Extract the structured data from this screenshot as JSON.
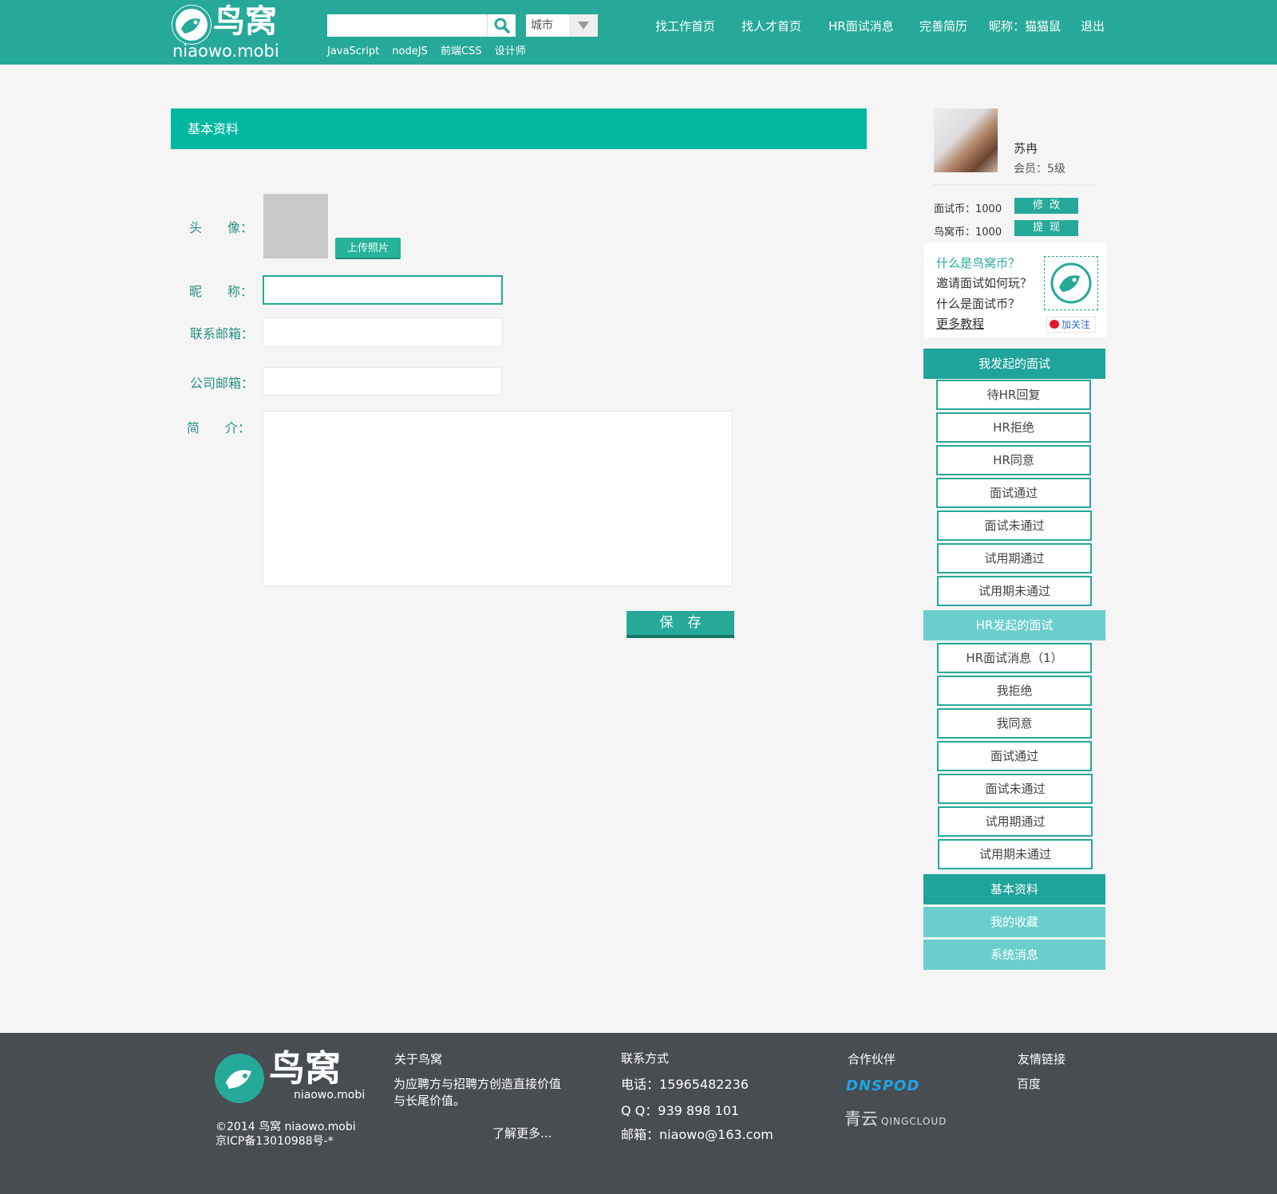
{
  "header": {
    "logo_cn": "鸟窝",
    "logo_en": "niaowo.mobi",
    "search_placeholder": "",
    "city": "城市",
    "hot_tags": [
      "JavaScript",
      "nodeJS",
      "前端CSS",
      "设计师"
    ],
    "nav": {
      "find_job": "找工作首页",
      "find_talent": "找人才首页",
      "hr_messages": "HR面试消息",
      "resume": "完善简历",
      "nickname": "昵称：猫猫鼠",
      "logout": "退出"
    }
  },
  "main": {
    "title": "基本资料",
    "labels": {
      "avatar": "头　　像：",
      "nickname": "昵　　称：",
      "contact_email": "联系邮箱：",
      "company_email": "公司邮箱：",
      "intro": "简　　介："
    },
    "upload_label": "上传照片",
    "values": {
      "nickname": "",
      "contact_email": "",
      "company_email": "",
      "intro": ""
    },
    "save_label": "保存"
  },
  "sidebar": {
    "name": "苏冉",
    "level": "会员：5级",
    "interview_coins": "面试币：1000",
    "niaowo_coins": "鸟窝币：1000",
    "edit_label": "修改",
    "withdraw_label": "提现",
    "tutorial": {
      "q1": "什么是鸟窝币？",
      "q2": "邀请面试如何玩？",
      "q3": "什么是面试币？",
      "more": "更多教程",
      "follow": "加关注"
    },
    "my_interviews_title": "我发起的面试",
    "my_interviews": [
      "待HR回复",
      "HR拒绝",
      "HR同意",
      "面试通过",
      "面试未通过",
      "试用期通过",
      "试用期未通过"
    ],
    "hr_interviews_title": "HR发起的面试",
    "hr_interviews": [
      "HR面试消息（1）",
      "我拒绝",
      "我同意",
      "面试通过",
      "面试未通过",
      "试用期通过",
      "试用期未通过"
    ],
    "nav": [
      "基本资料",
      "我的收藏",
      "系统消息"
    ]
  },
  "footer": {
    "logo_cn": "鸟窝",
    "logo_en": "niaowo.mobi",
    "copyright": "©2014 鸟窝 niaowo.mobi",
    "icp": "京ICP备13010988号-*",
    "about_title": "关于鸟窝",
    "about_text": "为应聘方与招聘方创造直接价值与长尾价值。",
    "about_more": "了解更多...",
    "contact_title": "联系方式",
    "phone": "电话：15965482236",
    "qq": "Q Q：939 898 101",
    "email": "邮箱：niaowo@163.com",
    "partners_title": "合作伙伴",
    "partner1": "DNSPOD",
    "partner2_cn": "青云",
    "partner2_en": "QINGCLOUD",
    "links_title": "友情链接",
    "link1": "百度"
  },
  "colors": {
    "brand": "#26a999",
    "title_bar": "#00b8a0",
    "hr_section": "#6acfcc",
    "nav_active": "#1fa39a",
    "footer": "#484d52"
  }
}
